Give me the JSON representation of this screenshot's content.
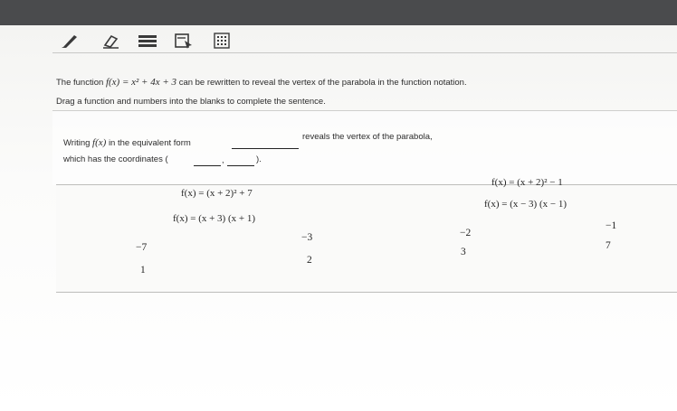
{
  "toolbar": {
    "tools": [
      "pencil-icon",
      "eraser-icon",
      "highlighter-icon",
      "reader-icon",
      "calculator-icon"
    ]
  },
  "question": {
    "prefix": "The function",
    "function": "f(x) = x² + 4x + 3",
    "suffix": "can be rewritten to reveal the vertex of the parabola in the function notation.",
    "instruction": "Drag a function and numbers into the blanks to complete the sentence."
  },
  "sentence": {
    "part1": "Writing",
    "fx": "f(x)",
    "part2": "in the equivalent form",
    "part3": "reveals the vertex of the parabola,",
    "part4": "which has the coordinates (",
    "comma": ",",
    "close": ")."
  },
  "choices": {
    "functions": [
      "f(x) = (x + 2)² + 7",
      "f(x) = (x + 2)² − 1",
      "f(x) = (x − 3) (x − 1)",
      "f(x) = (x + 3) (x + 1)"
    ],
    "numbers": [
      "−2",
      "−1",
      "−3",
      "−7",
      "7",
      "3",
      "2",
      "1"
    ]
  }
}
